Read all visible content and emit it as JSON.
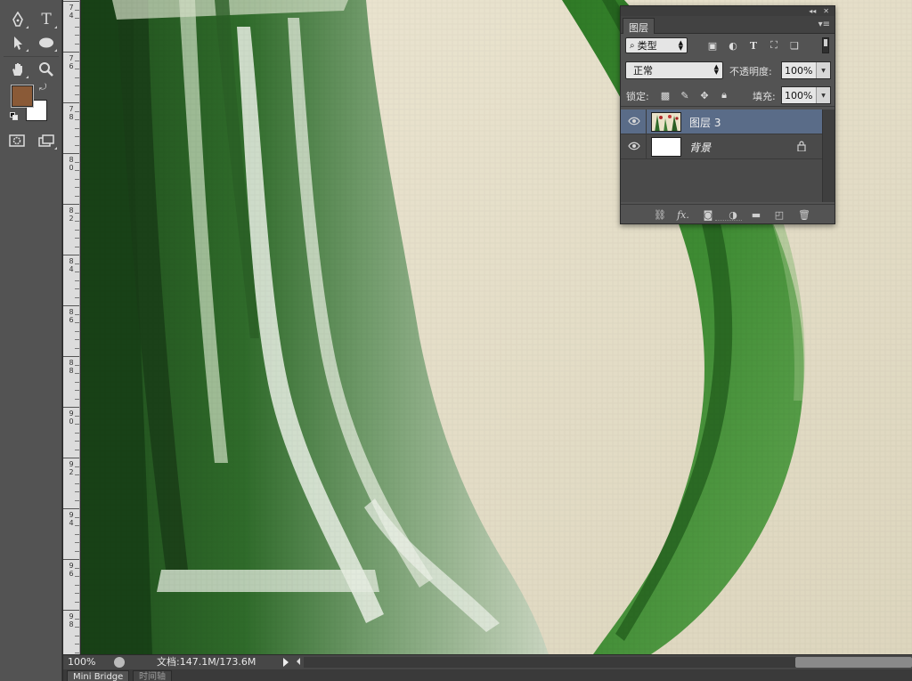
{
  "toolbox": {
    "tools": [
      {
        "name": "pen-tool",
        "icon": "pen-icon"
      },
      {
        "name": "type-tool",
        "icon": "type-icon",
        "glyph": "T"
      },
      {
        "name": "path-selection-tool",
        "icon": "arrow-icon"
      },
      {
        "name": "ellipse-tool",
        "icon": "ellipse-icon"
      },
      {
        "name": "hand-tool",
        "icon": "hand-icon"
      },
      {
        "name": "zoom-tool",
        "icon": "magnifier-icon"
      },
      {
        "name": "quick-mask-button",
        "icon": "quick-mask-icon"
      },
      {
        "name": "screen-mode-button",
        "icon": "screen-mode-icon"
      }
    ],
    "foreground_color": "#8a5a37",
    "background_color": "#ffffff"
  },
  "ruler": {
    "labels": [
      "7\n4",
      "7\n6",
      "7\n8",
      "8\n0",
      "8\n2",
      "8\n4",
      "8\n6",
      "8\n8",
      "9\n0",
      "9\n2",
      "9\n4",
      "9\n6",
      "9\n8"
    ]
  },
  "layers_panel": {
    "collapse_glyph": "◂◂",
    "close_glyph": "✕",
    "tab_label": "图层",
    "menu_glyph": "▾≡",
    "filter_kind": "类型",
    "blend_mode": "正常",
    "opacity_label": "不透明度:",
    "opacity_value": "100%",
    "lock_label": "锁定:",
    "fill_label": "填充:",
    "fill_value": "100%",
    "layers": [
      {
        "name": "图层 3",
        "selected": true,
        "visible": true,
        "locked": false
      },
      {
        "name": "背景",
        "selected": false,
        "visible": true,
        "locked": true
      }
    ],
    "footer_fx_label": "fx."
  },
  "statusbar": {
    "zoom": "100%",
    "doc_info": "文档:147.1M/173.6M"
  },
  "bottom_tabs": [
    {
      "label": "Mini Bridge",
      "active": true
    },
    {
      "label": "时间轴",
      "active": false
    }
  ],
  "colors": {
    "selected_layer": "#5a6c88",
    "panel_bg": "#535353"
  }
}
